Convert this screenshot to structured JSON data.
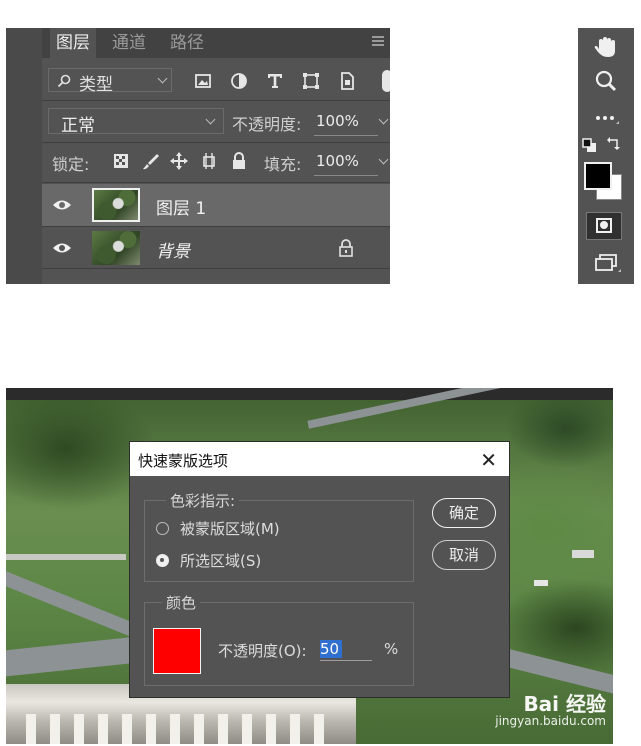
{
  "layers_panel": {
    "tabs": [
      {
        "label": "图层",
        "active": true
      },
      {
        "label": "通道",
        "active": false
      },
      {
        "label": "路径",
        "active": false
      }
    ],
    "filter": {
      "label": "类型",
      "icons": [
        "image-filter-icon",
        "adjustment-filter-icon",
        "type-filter-icon",
        "shape-filter-icon",
        "smart-object-filter-icon"
      ]
    },
    "blend_mode": "正常",
    "opacity": {
      "label": "不透明度:",
      "value": "100%"
    },
    "lock": {
      "label": "锁定:",
      "icons": [
        "lock-transparent-icon",
        "lock-image-icon",
        "lock-position-icon",
        "lock-artboard-icon",
        "lock-all-icon"
      ]
    },
    "fill": {
      "label": "填充:",
      "value": "100%"
    },
    "layers": [
      {
        "name": "图层 1",
        "selected": true,
        "visible": true,
        "locked": false
      },
      {
        "name": "背景",
        "selected": false,
        "visible": true,
        "locked": true
      }
    ]
  },
  "tools": [
    "hand-tool-icon",
    "zoom-tool-icon",
    "more-tools-icon",
    "default-colors-icon",
    "swap-colors-icon",
    "foreground-background-icon",
    "quick-mask-icon",
    "screen-mode-icon"
  ],
  "dialog": {
    "title": "快速蒙版选项",
    "color_indicates": {
      "legend": "色彩指示:",
      "options": [
        {
          "label": "被蒙版区域(M)",
          "selected": false
        },
        {
          "label": "所选区域(S)",
          "selected": true
        }
      ]
    },
    "color_group": {
      "legend": "颜色",
      "swatch_color": "#ff0000",
      "opacity_label": "不透明度(O):",
      "opacity_value": "50",
      "opacity_unit": "%"
    },
    "ok_label": "确定",
    "cancel_label": "取消"
  },
  "watermark": {
    "main": "Bai 经验",
    "sub": "jingyan.baidu.com"
  }
}
